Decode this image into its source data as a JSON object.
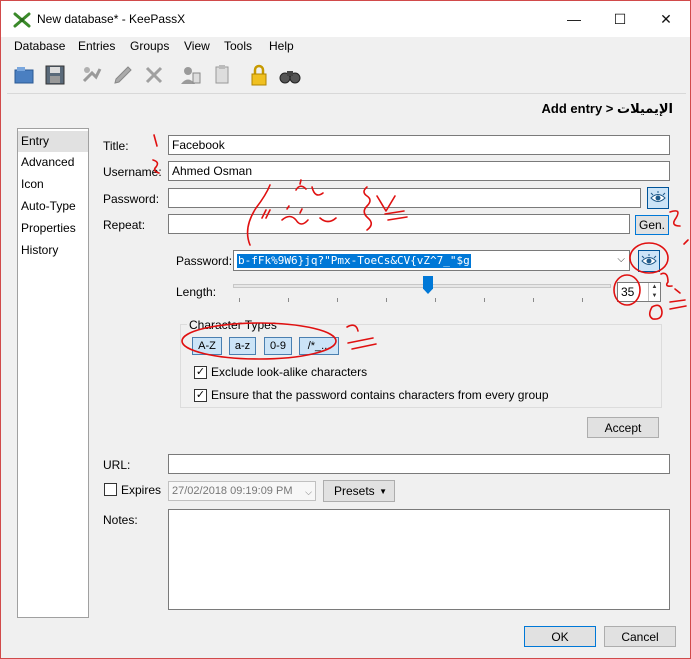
{
  "window": {
    "title": "New database* - KeePassX",
    "minimize": "—",
    "maximize": "☐",
    "close": "✕"
  },
  "menu": [
    "Database",
    "Entries",
    "Groups",
    "View",
    "Tools",
    "Help"
  ],
  "toolbar_icons": [
    "open-database-icon",
    "save-database-icon",
    "add-entry-icon",
    "edit-entry-icon",
    "delete-entry-icon",
    "copy-username-icon",
    "copy-password-icon",
    "lock-icon",
    "search-icon"
  ],
  "header": {
    "label": "Add entry > الإيميلات"
  },
  "sidebar": {
    "items": [
      {
        "label": "Entry",
        "selected": true
      },
      {
        "label": "Advanced"
      },
      {
        "label": "Icon"
      },
      {
        "label": "Auto-Type"
      },
      {
        "label": "Properties"
      },
      {
        "label": "History"
      }
    ]
  },
  "form": {
    "title_label": "Title:",
    "title_value": "Facebook",
    "username_label": "Username:",
    "username_value": "Ahmed Osman",
    "password_label": "Password:",
    "password_value": "",
    "repeat_label": "Repeat:",
    "repeat_value": "",
    "gen_label": "Gen.",
    "url_label": "URL:",
    "url_value": "",
    "expires_label": "Expires",
    "expires_value": "27/02/2018 09:19:09 PM",
    "presets_label": "Presets",
    "notes_label": "Notes:"
  },
  "generator": {
    "password_label": "Password:",
    "password_value": "b-fFk%9W6}jq?\"Pmx-ToeCs&CV{vZ^7_\"$g",
    "length_label": "Length:",
    "length_value": "35",
    "char_types_title": "Character Types",
    "char_types": [
      "A-Z",
      "a-z",
      "0-9",
      "/*_..."
    ],
    "exclude_lookalike": "Exclude look-alike characters",
    "ensure_every_group": "Ensure that the password contains characters from every group",
    "accept_label": "Accept"
  },
  "footer": {
    "ok_label": "OK",
    "cancel_label": "Cancel"
  },
  "colors": {
    "accent": "#0078d7",
    "annotation": "#e01010",
    "frame": "#d14a4a"
  }
}
